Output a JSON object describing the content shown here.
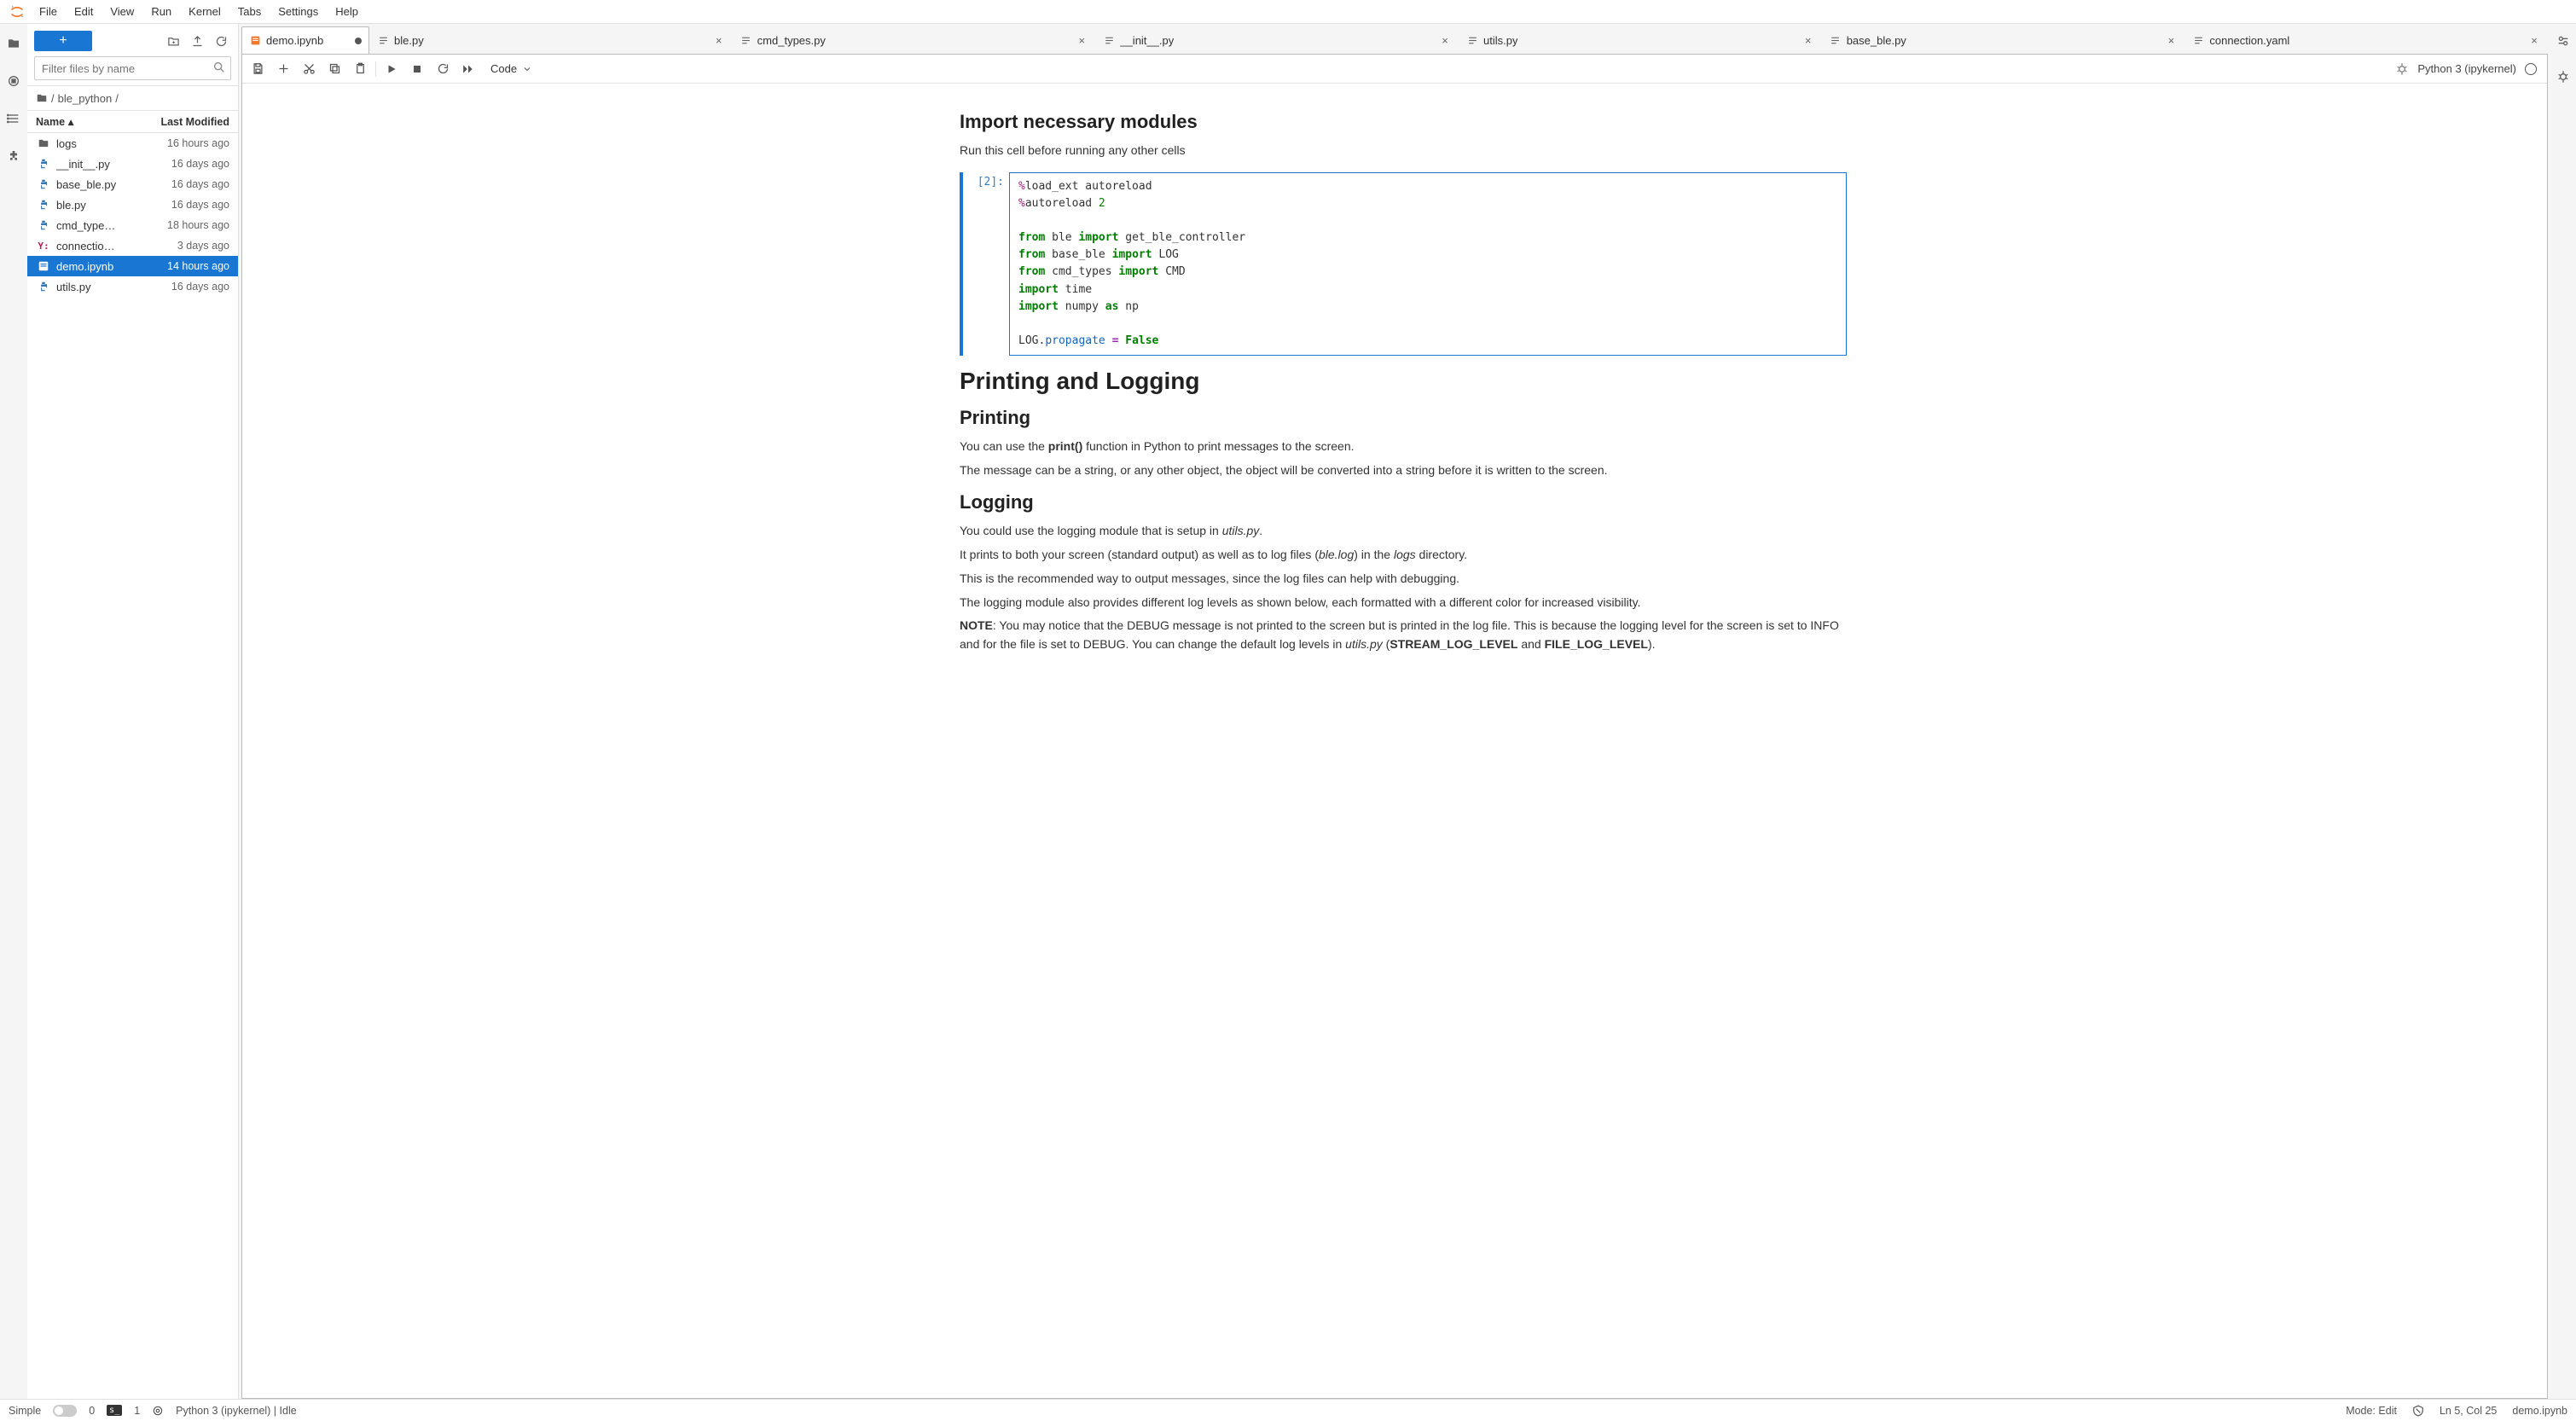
{
  "menu": {
    "items": [
      "File",
      "Edit",
      "View",
      "Run",
      "Kernel",
      "Tabs",
      "Settings",
      "Help"
    ]
  },
  "filebrowser": {
    "filter_placeholder": "Filter files by name",
    "breadcrumb": {
      "root": "/",
      "path": "ble_python",
      "trail": "/"
    },
    "header": {
      "name": "Name",
      "modified": "Last Modified"
    },
    "items": [
      {
        "icon": "folder",
        "name": "logs",
        "modified": "16 hours ago",
        "selected": false
      },
      {
        "icon": "python",
        "name": "__init__.py",
        "modified": "16 days ago",
        "selected": false
      },
      {
        "icon": "python",
        "name": "base_ble.py",
        "modified": "16 days ago",
        "selected": false
      },
      {
        "icon": "python",
        "name": "ble.py",
        "modified": "16 days ago",
        "selected": false
      },
      {
        "icon": "python",
        "name": "cmd_type…",
        "modified": "18 hours ago",
        "selected": false
      },
      {
        "icon": "yaml",
        "name": "connectio…",
        "modified": "3 days ago",
        "selected": false
      },
      {
        "icon": "notebook",
        "name": "demo.ipynb",
        "modified": "14 hours ago",
        "selected": true
      },
      {
        "icon": "python",
        "name": "utils.py",
        "modified": "16 days ago",
        "selected": false
      }
    ]
  },
  "tabs": [
    {
      "icon": "notebook",
      "label": "demo.ipynb",
      "active": true,
      "dirty": true
    },
    {
      "icon": "text",
      "label": "ble.py",
      "active": false,
      "dirty": false
    },
    {
      "icon": "text",
      "label": "cmd_types.py",
      "active": false,
      "dirty": false
    },
    {
      "icon": "text",
      "label": "__init__.py",
      "active": false,
      "dirty": false
    },
    {
      "icon": "text",
      "label": "utils.py",
      "active": false,
      "dirty": false
    },
    {
      "icon": "text",
      "label": "base_ble.py",
      "active": false,
      "dirty": false
    },
    {
      "icon": "text",
      "label": "connection.yaml",
      "active": false,
      "dirty": false
    }
  ],
  "nb_toolbar": {
    "cell_type": "Code",
    "kernel_name": "Python 3 (ipykernel)"
  },
  "notebook": {
    "md1_h2": "Import necessary modules",
    "md1_p": "Run this cell before running any other cells",
    "code_prompt": "[2]:",
    "md2_h1": "Printing and Logging",
    "md3_h2": "Printing",
    "md3_p1a": "You can use the ",
    "md3_p1b": "print()",
    "md3_p1c": " function in Python to print messages to the screen.",
    "md3_p2": "The message can be a string, or any other object, the object will be converted into a string before it is written to the screen.",
    "md4_h2": "Logging",
    "md4_p1a": "You could use the logging module that is setup in ",
    "md4_p1b": "utils.py",
    "md4_p1c": ".",
    "md4_p2a": "It prints to both your screen (standard output) as well as to log files (",
    "md4_p2b": "ble.log",
    "md4_p2c": ") in the ",
    "md4_p2d": "logs",
    "md4_p2e": " directory.",
    "md4_p3": "This is the recommended way to output messages, since the log files can help with debugging.",
    "md4_p4": "The logging module also provides different log levels as shown below, each formatted with a different color for increased visibility.",
    "md4_p5a": "NOTE",
    "md4_p5b": ": You may notice that the DEBUG message is not printed to the screen but is printed in the log file. This is because the logging level for the screen is set to INFO and for the file is set to DEBUG. You can change the default log levels in ",
    "md4_p5c": "utils.py",
    "md4_p5d": " (",
    "md4_p5e": "STREAM_LOG_LEVEL",
    "md4_p5f": " and ",
    "md4_p5g": "FILE_LOG_LEVEL",
    "md4_p5h": ")."
  },
  "code": {
    "l1a": "%",
    "l1b": "load_ext autoreload",
    "l2a": "%",
    "l2b": "autoreload ",
    "l2c": "2",
    "l3_blank": "",
    "l4a": "from",
    "l4b": " ble ",
    "l4c": "import",
    "l4d": " get_ble_controller",
    "l5a": "from",
    "l5b": " base_ble ",
    "l5c": "import",
    "l5d": " LOG",
    "l6a": "from",
    "l6b": " cmd_types ",
    "l6c": "import",
    "l6d": " CMD",
    "l7a": "import",
    "l7b": " time",
    "l8a": "import",
    "l8b": " numpy ",
    "l8c": "as",
    "l8d": " np",
    "l9_blank": "",
    "l10a": "LOG.",
    "l10b": "propagate",
    "l10c": " ",
    "l10d": "=",
    "l10e": " ",
    "l10f": "False"
  },
  "status": {
    "simple": "Simple",
    "zero": "0",
    "one": "1",
    "kernel": "Python 3 (ipykernel) | Idle",
    "mode": "Mode: Edit",
    "lncol": "Ln 5, Col 25",
    "file": "demo.ipynb",
    "term": "s_"
  }
}
